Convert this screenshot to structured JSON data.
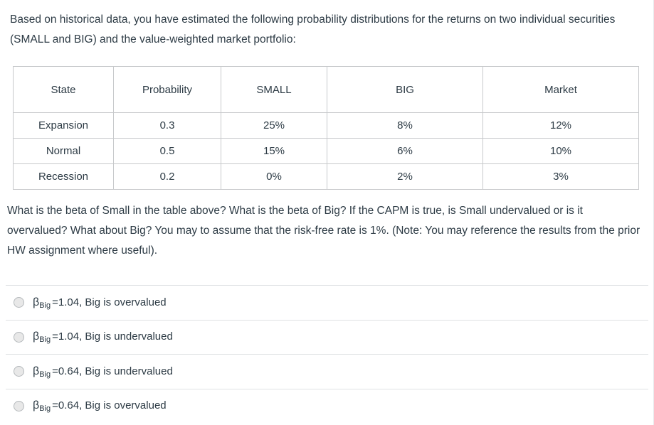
{
  "prompt": {
    "text": "Based on historical data, you have estimated the following probability distributions for the returns on two individual securities (SMALL and BIG) and the value-weighted market portfolio:"
  },
  "table": {
    "headers": [
      "State",
      "Probability",
      "SMALL",
      "BIG",
      "Market"
    ],
    "rows": [
      [
        "Expansion",
        "0.3",
        "25%",
        "8%",
        "12%"
      ],
      [
        "Normal",
        "0.5",
        "15%",
        "6%",
        "10%"
      ],
      [
        "Recession",
        "0.2",
        "0%",
        "2%",
        "3%"
      ]
    ]
  },
  "question": {
    "text": "What is the beta of Small in the table above?  What is the beta of Big?  If the CAPM is true, is Small undervalued or is it overvalued?  What about Big?  You may to assume that the risk-free rate is 1%. (Note: You may reference the results from the prior HW assignment where useful)."
  },
  "answers": {
    "options": [
      {
        "symbol": "β",
        "subscript": "Big",
        "text": "=1.04, Big is overvalued",
        "selected": false
      },
      {
        "symbol": "β",
        "subscript": "Big",
        "text": "=1.04, Big is undervalued",
        "selected": false
      },
      {
        "symbol": "β",
        "subscript": "Big",
        "text": "=0.64, Big is undervalued",
        "selected": false
      },
      {
        "symbol": "β",
        "subscript": "Big",
        "text": "=0.64, Big is overvalued",
        "selected": false
      }
    ]
  },
  "colors": {
    "text": "#2d3b45",
    "table_border": "#3b4146",
    "table_inner_border": "#c7c9cb",
    "divider": "#dfe2e4",
    "radio_fill": "#e8e8e8"
  }
}
